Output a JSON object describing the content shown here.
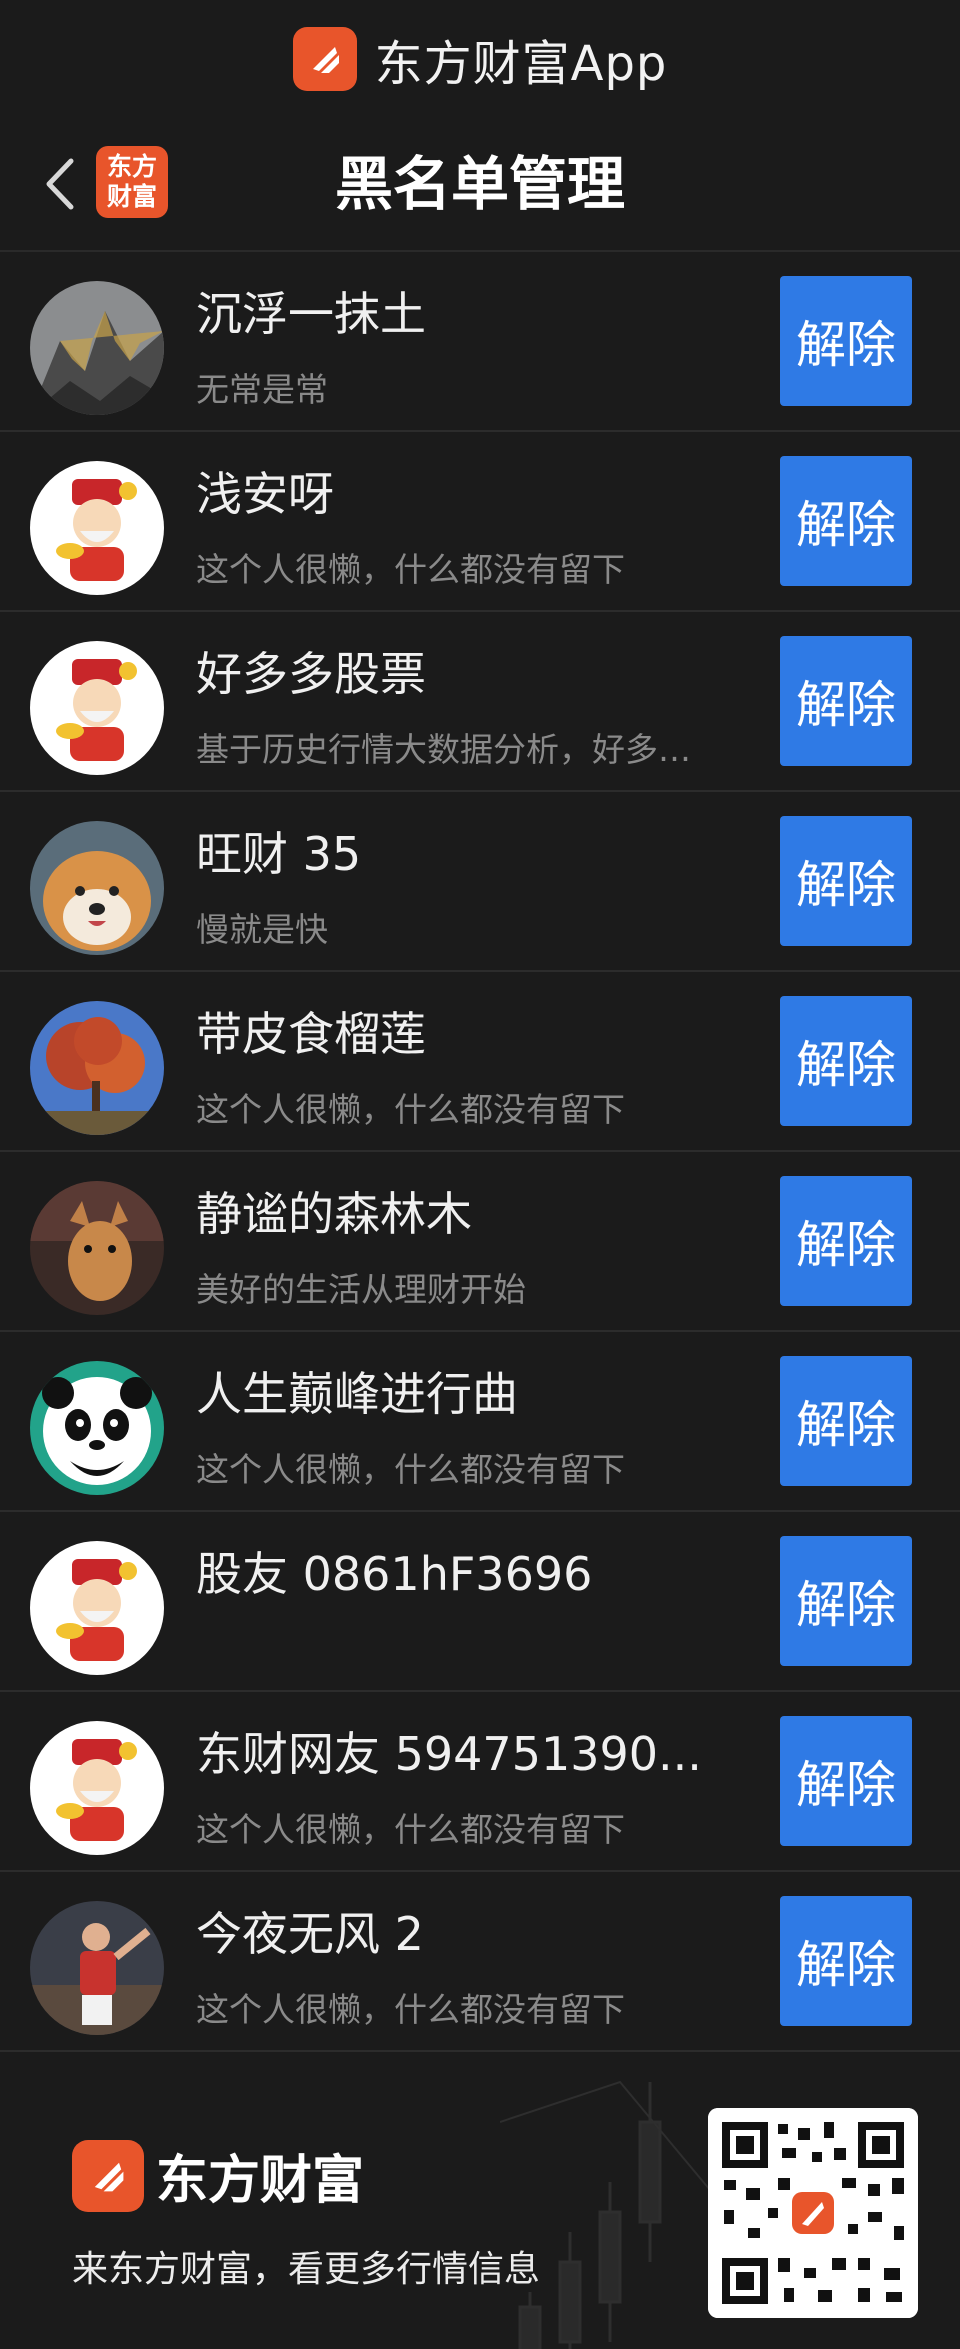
{
  "app_banner": {
    "text": "东方财富App"
  },
  "nav": {
    "badge_line1": "东方",
    "badge_line2": "财富",
    "title": "黑名单管理"
  },
  "list": [
    {
      "name": "沉浮一抹土",
      "sign": "无常是常",
      "button": "解除",
      "avatar": "mountain"
    },
    {
      "name": "浅安呀",
      "sign": "这个人很懒，什么都没有留下",
      "button": "解除",
      "avatar": "fortune-god"
    },
    {
      "name": "好多多股票",
      "sign": "基于历史行情大数据分析，好多…",
      "button": "解除",
      "avatar": "fortune-god"
    },
    {
      "name": "旺财 35",
      "sign": "慢就是快",
      "button": "解除",
      "avatar": "shiba-dog"
    },
    {
      "name": "带皮食榴莲",
      "sign": "这个人很懒，什么都没有留下",
      "button": "解除",
      "avatar": "red-tree"
    },
    {
      "name": "静谧的森林木",
      "sign": "美好的生活从理财开始",
      "button": "解除",
      "avatar": "dog-photo"
    },
    {
      "name": "人生巅峰进行曲",
      "sign": "这个人很懒，什么都没有留下",
      "button": "解除",
      "avatar": "panda"
    },
    {
      "name": "股友 0861hF3696",
      "sign": "",
      "button": "解除",
      "avatar": "fortune-god"
    },
    {
      "name": "东财网友 594751390...",
      "sign": "这个人很懒，什么都没有留下",
      "button": "解除",
      "avatar": "fortune-god"
    },
    {
      "name": "今夜无风 2",
      "sign": "这个人很懒，什么都没有留下",
      "button": "解除",
      "avatar": "athlete"
    }
  ],
  "footer": {
    "brand": "东方财富",
    "slogan": "来东方财富，看更多行情信息"
  },
  "colors": {
    "accent": "#2f7ae5",
    "brand": "#e8552b",
    "background": "#1b1b1b"
  }
}
